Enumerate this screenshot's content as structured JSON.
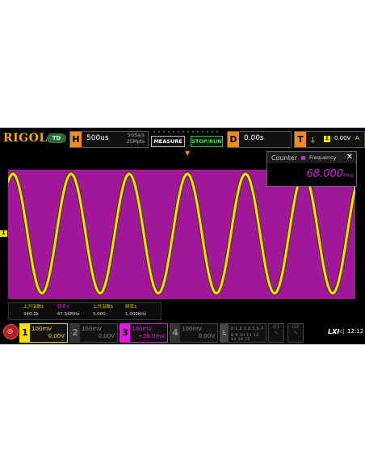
{
  "brand": {
    "logo": "RIGOL",
    "mode_badge": "TD"
  },
  "horizontal": {
    "tag": "H",
    "timebase": "500us",
    "sample_rate": "5GSa/s",
    "memory_depth": "25Mpts"
  },
  "buttons": {
    "measure": "MEASURE",
    "stop_run": "STOP/RUN"
  },
  "delay": {
    "tag": "D",
    "value": "0.00s"
  },
  "trigger": {
    "tag": "T",
    "source": "1",
    "level": "0.00V",
    "mode": "A"
  },
  "counter": {
    "title": "Counter",
    "source": "Frequency",
    "close": "✕",
    "value": "68.000",
    "unit": "MHz"
  },
  "measurements": [
    {
      "label": "上升沿数1",
      "value": "340.0k",
      "label_color": "yellow"
    },
    {
      "label": "频率3",
      "value": "67.56MHz",
      "label_color": "magenta"
    },
    {
      "label": "上升沿数1",
      "value": "5.000",
      "label_color": "yellow"
    },
    {
      "label": "频率1",
      "value": "1.000kHz",
      "label_color": "yellow"
    }
  ],
  "channels": [
    {
      "num": "1",
      "scale": "100mV",
      "offset": "0.00V",
      "color": "#f2e000",
      "active": true
    },
    {
      "num": "2",
      "scale": "100mV",
      "offset": "0.00V",
      "color": "#888888",
      "active": false
    },
    {
      "num": "3",
      "scale": "100mV",
      "offset": "+36.0mV",
      "color": "#e01ae0",
      "active": true
    },
    {
      "num": "4",
      "scale": "100mV",
      "offset": "0.00V",
      "color": "#888888",
      "active": false
    }
  ],
  "la": {
    "tag": "L",
    "row1": "0 1 2 3   4 5 6 7",
    "row2": "8 9 10 11 12 13 14 15"
  },
  "generators": [
    "G1",
    "G2"
  ],
  "status": {
    "lxi": "LXI",
    "time": "12:12"
  },
  "colors": {
    "ch1": "#f2e000",
    "ch3": "#e01ae0",
    "accent": "#f08a18",
    "run": "#3ee04e",
    "fill": "#a0179a"
  }
}
